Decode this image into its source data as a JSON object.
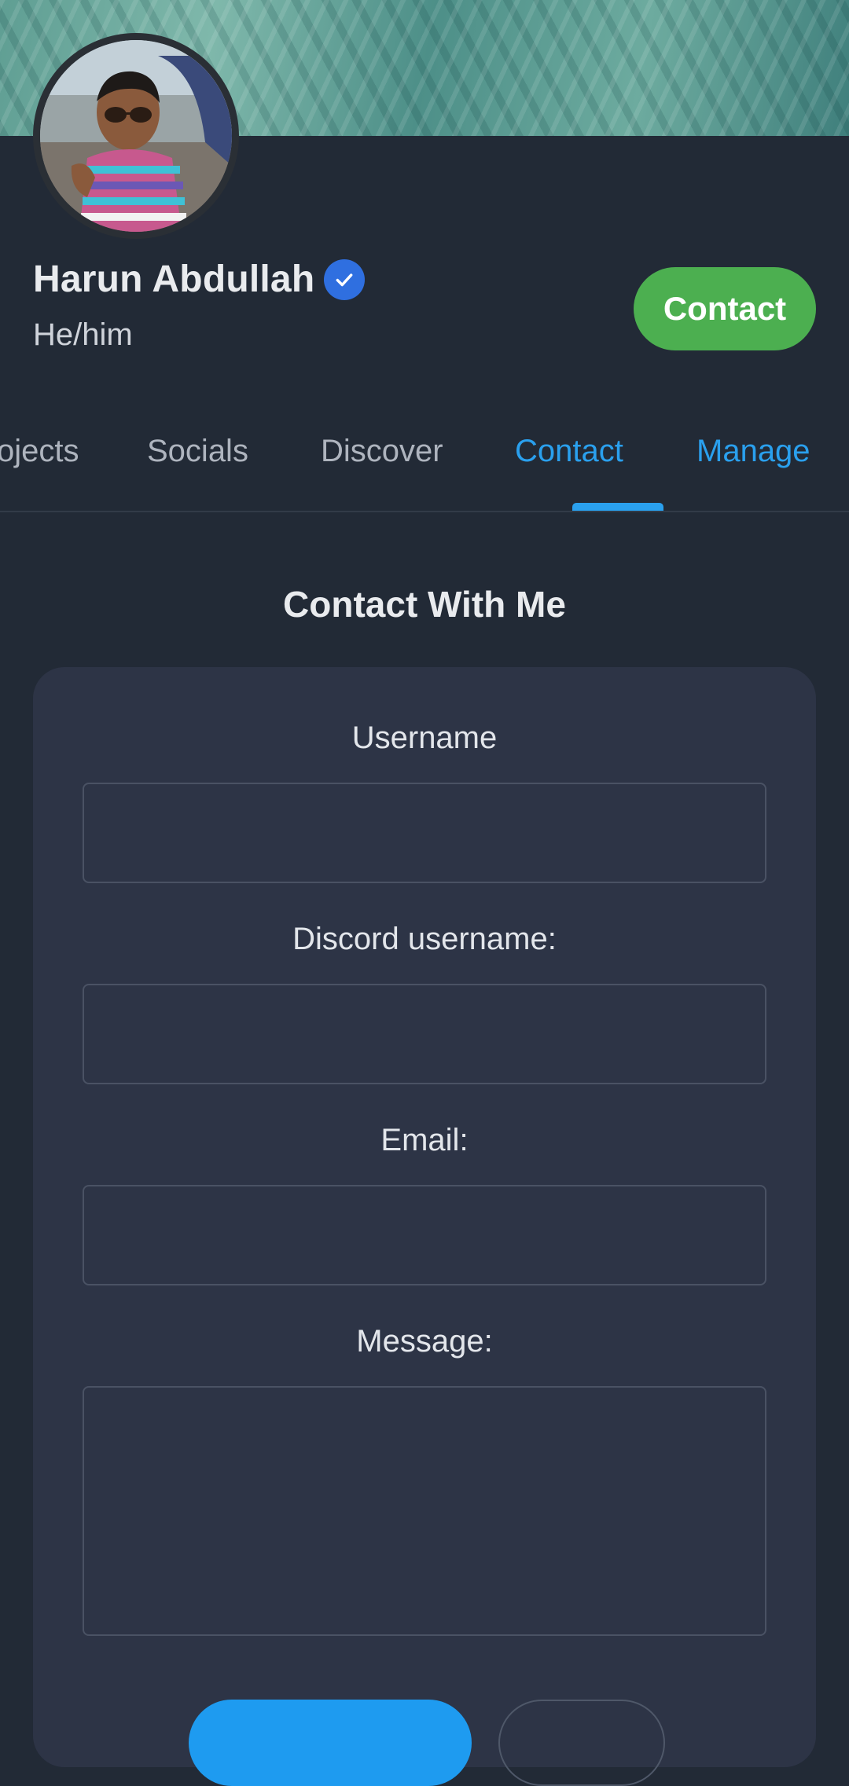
{
  "profile": {
    "name": "Harun Abdullah",
    "pronouns": "He/him",
    "contact_button": "Contact"
  },
  "tabs": [
    {
      "label": "ojects"
    },
    {
      "label": "Socials"
    },
    {
      "label": "Discover"
    },
    {
      "label": "Contact"
    },
    {
      "label": "Manage"
    }
  ],
  "active_tab": "Contact",
  "contact_form": {
    "title": "Contact With Me",
    "fields": [
      {
        "label": "Username",
        "value": ""
      },
      {
        "label": "Discord username:",
        "value": ""
      },
      {
        "label": "Email:",
        "value": ""
      },
      {
        "label": "Message:",
        "value": ""
      }
    ]
  },
  "colors": {
    "background": "#222a36",
    "card": "#2d3446",
    "accent": "#2aa0ee",
    "contact_button": "#4caf50",
    "verified_badge": "#2f6fe0"
  },
  "icons": [
    "verified-check-icon"
  ]
}
